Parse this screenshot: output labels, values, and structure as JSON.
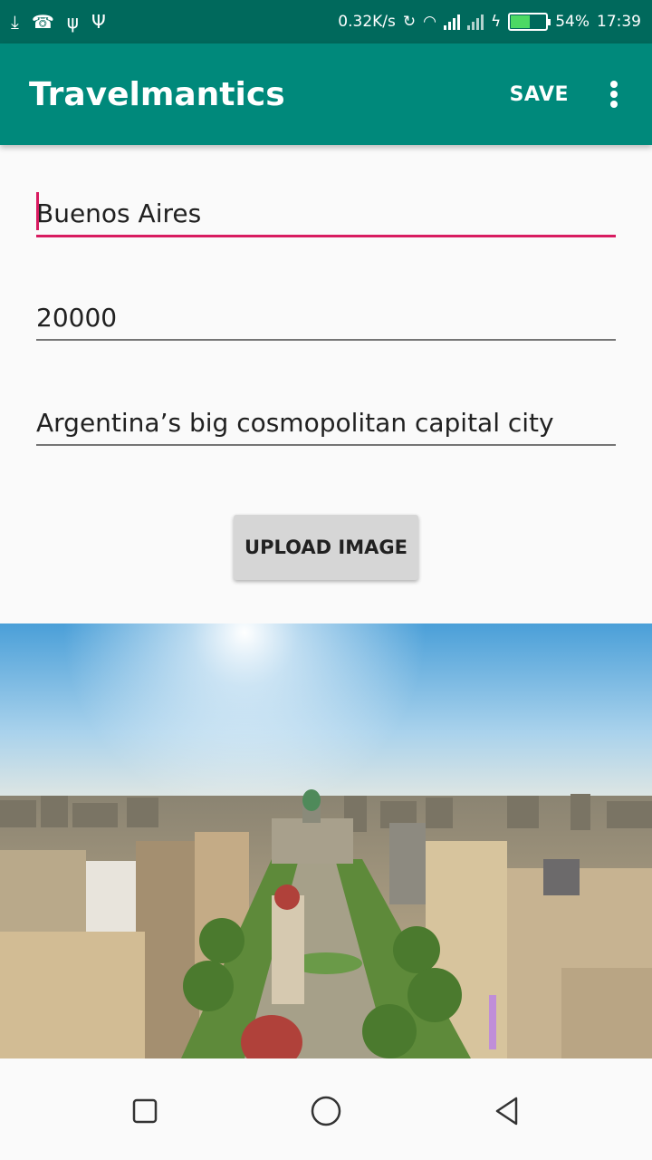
{
  "status_bar": {
    "left_icons": [
      "download-icon",
      "missed-call-icon",
      "usb-icon",
      "usb-debug-icon"
    ],
    "net_speed": "0.32K/s",
    "battery_percent": "54%",
    "battery_level": 0.54,
    "time": "17:39"
  },
  "app_bar": {
    "title": "Travelmantics",
    "save_label": "SAVE"
  },
  "form": {
    "title_value": "Buenos Aires",
    "price_value": "20000",
    "description_value": "Argentina’s big cosmopolitan capital city",
    "upload_label": "UPLOAD IMAGE"
  },
  "colors": {
    "status_bar": "#00695c",
    "app_bar": "#00897b",
    "accent": "#d81b60"
  },
  "nav_bar": {
    "icons": [
      "recents-square-icon",
      "home-circle-icon",
      "back-triangle-icon"
    ]
  }
}
